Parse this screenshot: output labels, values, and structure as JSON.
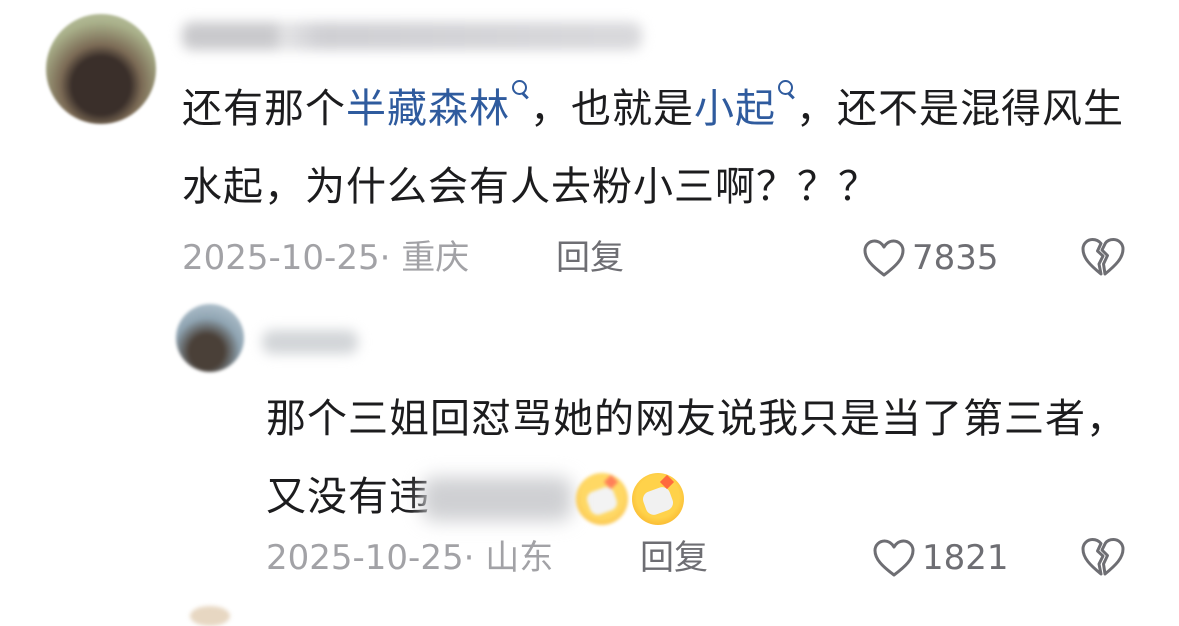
{
  "comment": {
    "text_before_kw1": "还有那个",
    "keyword1": "半藏森林",
    "text_between_kw": "，也就是",
    "keyword2": "小起",
    "text_after_kw2": "，还不是混得风生水起，为什么会有人去粉小三啊？？？",
    "date": "2025-10-25· 重庆",
    "reply_label": "回复",
    "likes": "7835",
    "icons": {
      "like": "heart-icon",
      "dislike": "broken-heart-icon",
      "search": "search-icon"
    }
  },
  "reply": {
    "text_before_redaction": "那个三姐回怼骂她的网友说我只是当了第三者，又没有违",
    "date": "2025-10-25· 山东",
    "reply_label": "回复",
    "likes": "1821",
    "emoji": "shocked-face-emoji"
  },
  "colors": {
    "text": "#1c1c1e",
    "keyword": "#2f5b9e",
    "meta": "#a2a2a6",
    "action": "#6e6e73"
  }
}
